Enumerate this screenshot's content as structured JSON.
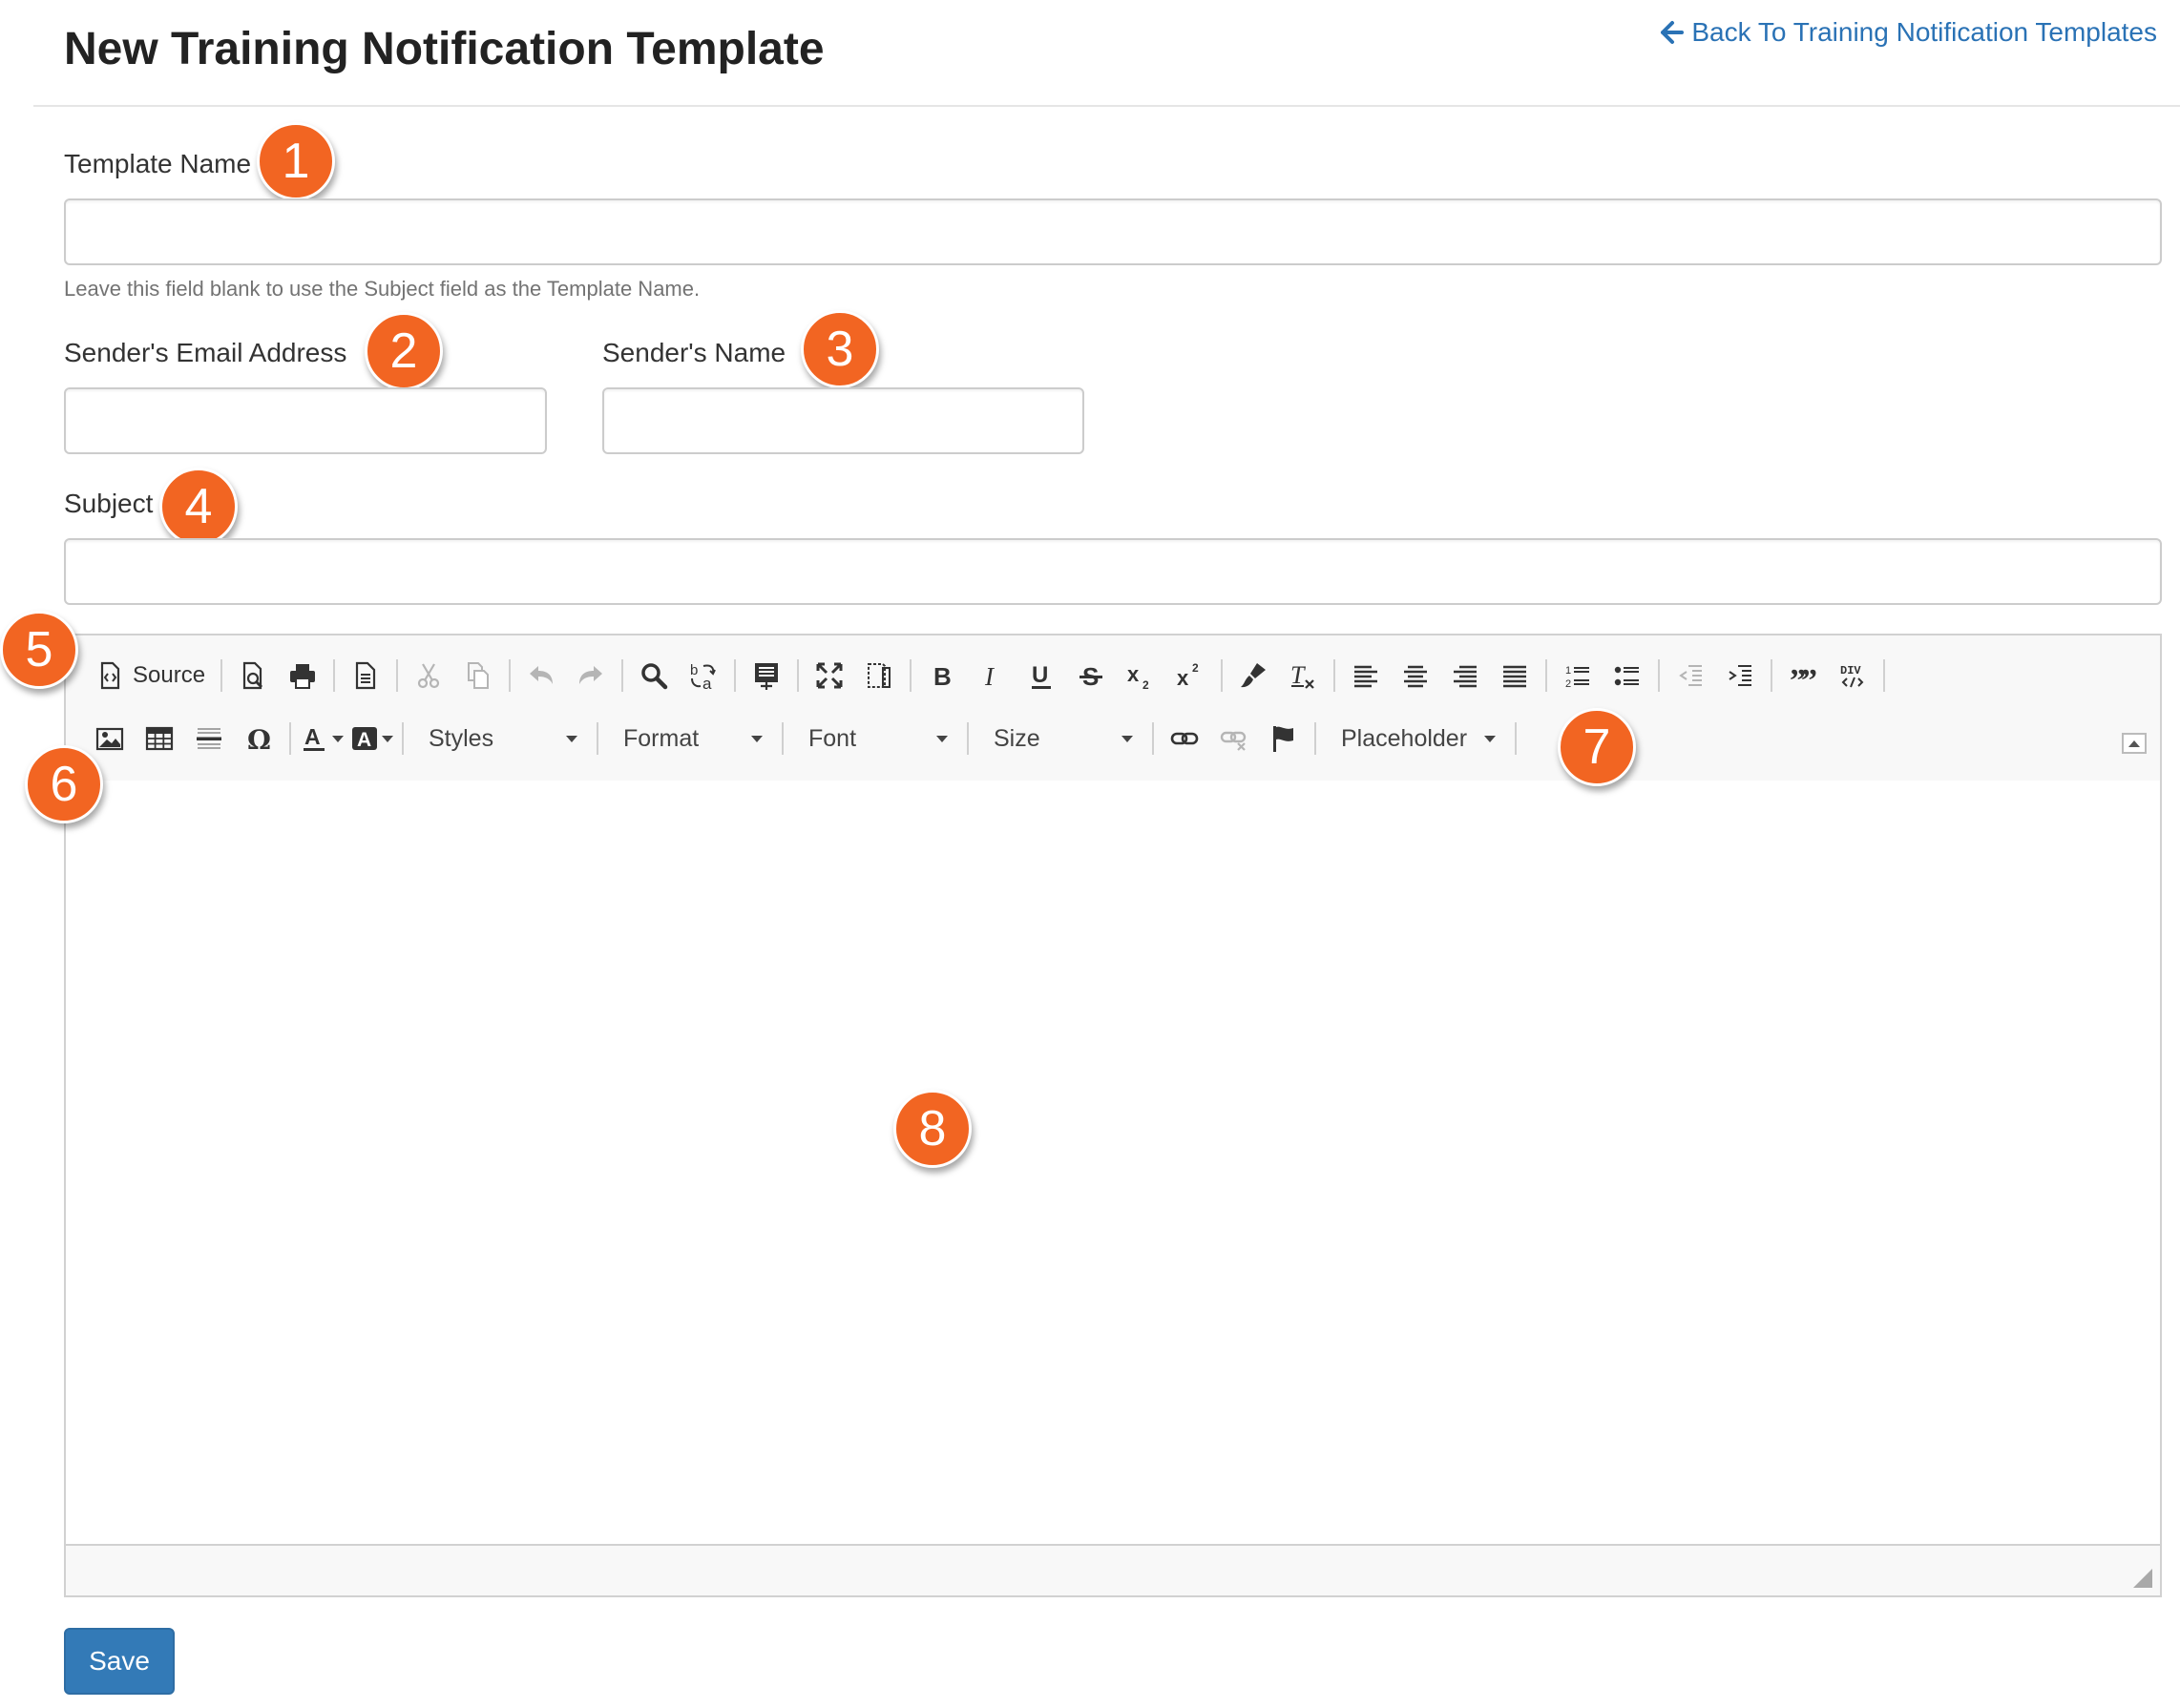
{
  "header": {
    "title": "New Training Notification Template",
    "back_link": "Back To Training Notification Templates"
  },
  "form": {
    "template_name": {
      "label": "Template Name",
      "value": "",
      "help": "Leave this field blank to use the Subject field as the Template Name."
    },
    "sender_email": {
      "label": "Sender's Email Address",
      "value": ""
    },
    "sender_name": {
      "label": "Sender's Name",
      "value": ""
    },
    "subject": {
      "label": "Subject",
      "value": ""
    }
  },
  "editor": {
    "toolbar_row1": [
      {
        "name": "source-button",
        "icon": "source-icon",
        "label": "Source"
      },
      {
        "name": "preview-button",
        "icon": "preview-icon"
      },
      {
        "name": "print-button",
        "icon": "print-icon"
      },
      {
        "name": "templates-button",
        "icon": "document-icon"
      },
      {
        "name": "cut-button",
        "icon": "scissors-icon",
        "disabled": true
      },
      {
        "name": "copy-button",
        "icon": "copy-icon",
        "disabled": true
      },
      {
        "name": "undo-button",
        "icon": "undo-icon",
        "disabled": true
      },
      {
        "name": "redo-button",
        "icon": "redo-icon",
        "disabled": true
      },
      {
        "name": "find-button",
        "icon": "magnifier-icon"
      },
      {
        "name": "replace-button",
        "icon": "replace-icon"
      },
      {
        "name": "select-all-button",
        "icon": "select-all-icon"
      },
      {
        "name": "maximize-button",
        "icon": "maximize-icon"
      },
      {
        "name": "show-blocks-button",
        "icon": "show-blocks-icon"
      },
      {
        "name": "bold-button",
        "icon": "bold-icon"
      },
      {
        "name": "italic-button",
        "icon": "italic-icon"
      },
      {
        "name": "underline-button",
        "icon": "underline-icon"
      },
      {
        "name": "strikethrough-button",
        "icon": "strikethrough-icon"
      },
      {
        "name": "subscript-button",
        "icon": "subscript-icon"
      },
      {
        "name": "superscript-button",
        "icon": "superscript-icon"
      },
      {
        "name": "copy-formatting-button",
        "icon": "paintbrush-icon"
      },
      {
        "name": "remove-format-button",
        "icon": "remove-format-icon"
      },
      {
        "name": "align-left-button",
        "icon": "align-left-icon"
      },
      {
        "name": "align-center-button",
        "icon": "align-center-icon"
      },
      {
        "name": "align-right-button",
        "icon": "align-right-icon"
      },
      {
        "name": "justify-button",
        "icon": "justify-icon"
      },
      {
        "name": "numbered-list-button",
        "icon": "numbered-list-icon"
      },
      {
        "name": "bulleted-list-button",
        "icon": "bulleted-list-icon"
      },
      {
        "name": "outdent-button",
        "icon": "outdent-icon",
        "disabled": true
      },
      {
        "name": "indent-button",
        "icon": "indent-icon"
      },
      {
        "name": "blockquote-button",
        "icon": "quote-icon"
      },
      {
        "name": "create-div-button",
        "icon": "div-container-icon"
      }
    ],
    "toolbar_row2": {
      "combos": {
        "styles": "Styles",
        "format": "Format",
        "font": "Font",
        "size": "Size",
        "placeholder": "Placeholder"
      }
    },
    "content": ""
  },
  "callouts": [
    "1",
    "2",
    "3",
    "4",
    "5",
    "6",
    "7",
    "8"
  ],
  "actions": {
    "save": "Save"
  },
  "colors": {
    "accent": "#f26522",
    "link": "#2a72b5",
    "primary_button": "#337ab7"
  }
}
